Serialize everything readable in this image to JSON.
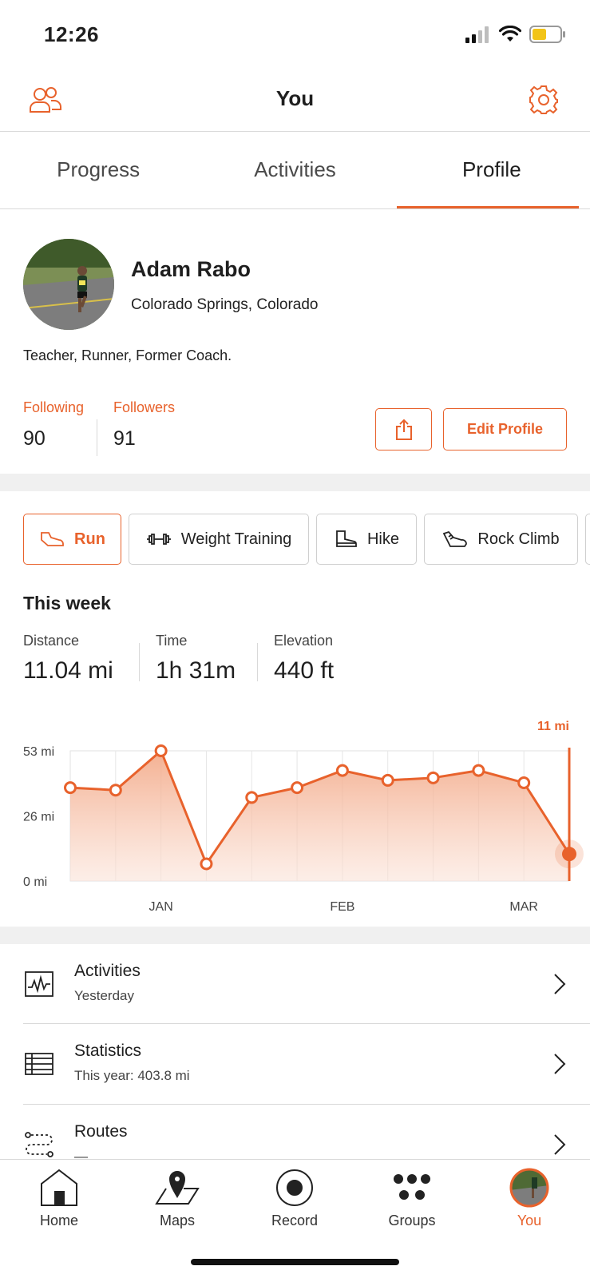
{
  "status_bar": {
    "time": "12:26"
  },
  "header": {
    "title": "You",
    "left_icon": "people-icon",
    "right_icon": "gear-icon"
  },
  "tabs": [
    {
      "label": "Progress",
      "active": false
    },
    {
      "label": "Activities",
      "active": false
    },
    {
      "label": "Profile",
      "active": true
    }
  ],
  "profile": {
    "name": "Adam Rabo",
    "location": "Colorado Springs, Colorado",
    "bio": "Teacher, Runner, Former Coach.",
    "following_label": "Following",
    "following_count": "90",
    "followers_label": "Followers",
    "followers_count": "91",
    "edit_label": "Edit Profile"
  },
  "sports": [
    {
      "label": "Run",
      "icon": "shoe-icon",
      "active": true
    },
    {
      "label": "Weight Training",
      "icon": "dumbbell-icon",
      "active": false
    },
    {
      "label": "Hike",
      "icon": "boot-icon",
      "active": false
    },
    {
      "label": "Rock Climb",
      "icon": "climbing-shoe-icon",
      "active": false
    }
  ],
  "this_week": {
    "title": "This week",
    "stats": [
      {
        "label": "Distance",
        "value": "11.04 mi"
      },
      {
        "label": "Time",
        "value": "1h 31m"
      },
      {
        "label": "Elevation",
        "value": "440 ft"
      }
    ]
  },
  "chart_data": {
    "type": "area",
    "y_tick_labels": [
      "53 mi",
      "26 mi",
      "0 mi"
    ],
    "ylim": [
      0,
      53
    ],
    "x_tick_labels": [
      "JAN",
      "FEB",
      "MAR"
    ],
    "x_label_at_week": [
      2,
      6,
      10
    ],
    "callout": "11 mi",
    "weeks": 12,
    "values": [
      38,
      37,
      53,
      7,
      34,
      38,
      45,
      41,
      42,
      45,
      40,
      11
    ],
    "color": "#e8622c",
    "grid": true
  },
  "list": [
    {
      "title": "Activities",
      "subtitle": "Yesterday",
      "icon": "activity-chart-icon"
    },
    {
      "title": "Statistics",
      "subtitle": "This year: 403.8 mi",
      "icon": "table-icon"
    },
    {
      "title": "Routes",
      "subtitle": "—",
      "icon": "route-icon"
    }
  ],
  "nav": [
    {
      "label": "Home",
      "icon": "home-icon",
      "active": false
    },
    {
      "label": "Maps",
      "icon": "map-icon",
      "active": false
    },
    {
      "label": "Record",
      "icon": "record-icon",
      "active": false
    },
    {
      "label": "Groups",
      "icon": "groups-icon",
      "active": false
    },
    {
      "label": "You",
      "icon": "avatar",
      "active": true
    }
  ],
  "colors": {
    "accent": "#e8622c"
  }
}
